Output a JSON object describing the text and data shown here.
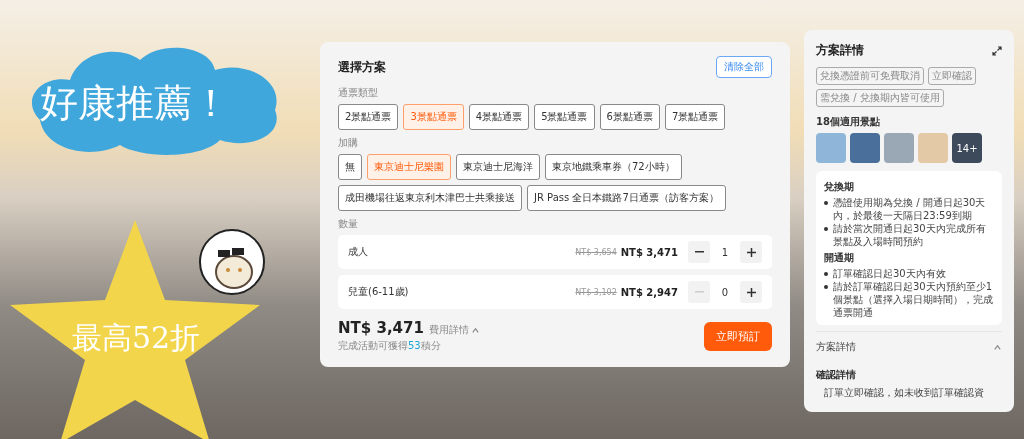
{
  "promo": {
    "headline": "好康推薦！",
    "discount": "最高52折"
  },
  "plan_panel": {
    "title": "選擇方案",
    "clear_button": "清除全部",
    "sections": [
      {
        "label": "通票類型",
        "options": [
          {
            "label": "2景點通票",
            "selected": false
          },
          {
            "label": "3景點通票",
            "selected": true
          },
          {
            "label": "4景點通票",
            "selected": false
          },
          {
            "label": "5景點通票",
            "selected": false
          },
          {
            "label": "6景點通票",
            "selected": false
          },
          {
            "label": "7景點通票",
            "selected": false
          }
        ]
      },
      {
        "label": "加購",
        "options": [
          {
            "label": "無",
            "selected": false
          },
          {
            "label": "東京迪士尼樂園",
            "selected": true
          },
          {
            "label": "東京迪士尼海洋",
            "selected": false
          },
          {
            "label": "東京地鐵乘車券（72小時）",
            "selected": false
          },
          {
            "label": "成田機場往返東京利木津巴士共乘接送",
            "selected": false
          },
          {
            "label": "JR Pass 全日本鐵路7日通票（訪客方案）",
            "selected": false
          }
        ]
      }
    ],
    "quantity": {
      "label": "數量",
      "rows": [
        {
          "name": "成人",
          "original_price": "NT$ 3,654",
          "price": "NT$ 3,471",
          "count": "1",
          "decrease_disabled": false
        },
        {
          "name": "兒童(6-11歲)",
          "original_price": "NT$ 3,102",
          "price": "NT$ 2,947",
          "count": "0",
          "decrease_disabled": true
        }
      ]
    },
    "footer": {
      "total": "NT$ 3,471",
      "details_link": "費用詳情",
      "details_expanded": true,
      "points_note": [
        {
          "text": "完成活動可獲得",
          "kind": "plain"
        },
        {
          "text": "53",
          "kind": "highlight"
        },
        {
          "text": "積分",
          "kind": "plain"
        }
      ],
      "book_button": "立即預訂"
    }
  },
  "detail_panel": {
    "title": "方案詳情",
    "tags": [
      "兌換憑證前可免費取消",
      "立即確認",
      "需兌換 / 兌換期內皆可使用"
    ],
    "attractions": {
      "title": "18個適用景點",
      "more": "14+"
    },
    "validity": [
      {
        "heading": "兌換期",
        "bullets": [
          "憑證使用期為兌換 / 開通日起30天內，於最後一天隔日23:59到期",
          "請於當次開通日起30天內完成所有景點及入場時間預約"
        ]
      },
      {
        "heading": "開通期",
        "bullets": [
          "訂單確認日起30天內有效",
          "請於訂單確認日起30天內預約至少1個景點（選擇入場日期時間），完成通票開通"
        ]
      }
    ],
    "section": {
      "title": "方案詳情",
      "expanded": true
    },
    "confirm": {
      "heading": "確認詳情",
      "text": "訂單立即確認，如未收到訂單確認資"
    }
  }
}
